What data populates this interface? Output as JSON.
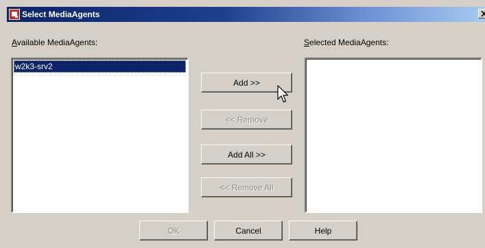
{
  "window": {
    "title": "Select MediaAgents",
    "icon": "app-logo-icon",
    "close_icon": "close-icon"
  },
  "available": {
    "label_mnemonic": "A",
    "label_rest": "vailable MediaAgents:",
    "items": [
      "w2k3-srv2"
    ],
    "selected_item": "w2k3-srv2"
  },
  "selected": {
    "label_mnemonic": "S",
    "label_rest": "elected MediaAgents:",
    "items": []
  },
  "transfer_buttons": {
    "add": "Add >>",
    "remove": "<< Remove",
    "add_all": "Add All >>",
    "remove_all": "<< Remove All"
  },
  "footer_buttons": {
    "ok": "OK",
    "cancel": "Cancel",
    "help": "Help"
  },
  "colors": {
    "title_bar_start": "#0a246a",
    "title_bar_end": "#a6caf0",
    "dialog_face": "#d4d0c8",
    "selection": "#0a246a",
    "app_icon_red": "#cc2a1c"
  }
}
